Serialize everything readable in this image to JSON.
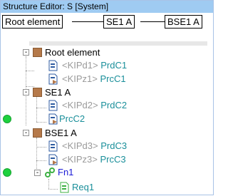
{
  "window": {
    "title": "Structure Editor: S [System]"
  },
  "breadcrumb": {
    "items": [
      "Root element",
      "SE1 A",
      "BSE1 A"
    ]
  },
  "tree": {
    "root": {
      "label": "Root element",
      "expander": "-",
      "children": [
        {
          "prefix": "<KIPd1>",
          "label": "PrdC1"
        },
        {
          "prefix": "<KIPz1>",
          "label": "PrcC1"
        }
      ]
    },
    "se1": {
      "label": "SE1 A",
      "expander": "-",
      "children": [
        {
          "prefix": "<KIPd2>",
          "label": "PrdC2"
        },
        {
          "prefix": "",
          "label": "PrcC2"
        }
      ]
    },
    "bse1": {
      "label": "BSE1 A",
      "expander": "-",
      "children": [
        {
          "prefix": "<KIPd3>",
          "label": "PrdC3"
        },
        {
          "prefix": "<KIPz3>",
          "label": "PrcC3"
        }
      ],
      "function": {
        "label": "Fn1",
        "expander": "-",
        "children": [
          {
            "label": "Req1"
          }
        ]
      }
    }
  },
  "colors": {
    "status_dot": "#1ed13e",
    "element_square": "#b5794a",
    "reference_text": "#1a8f9a",
    "function_text": "#1a1ad6",
    "key_text": "#9a9a9a",
    "titlebar": "#9fcbf2"
  },
  "icons": {
    "element": "element-square-icon",
    "product_doc": "product-document-icon",
    "process_doc": "process-document-icon",
    "function": "function-link-icon",
    "requirement": "requirement-document-icon",
    "status": "status-dot-icon"
  }
}
